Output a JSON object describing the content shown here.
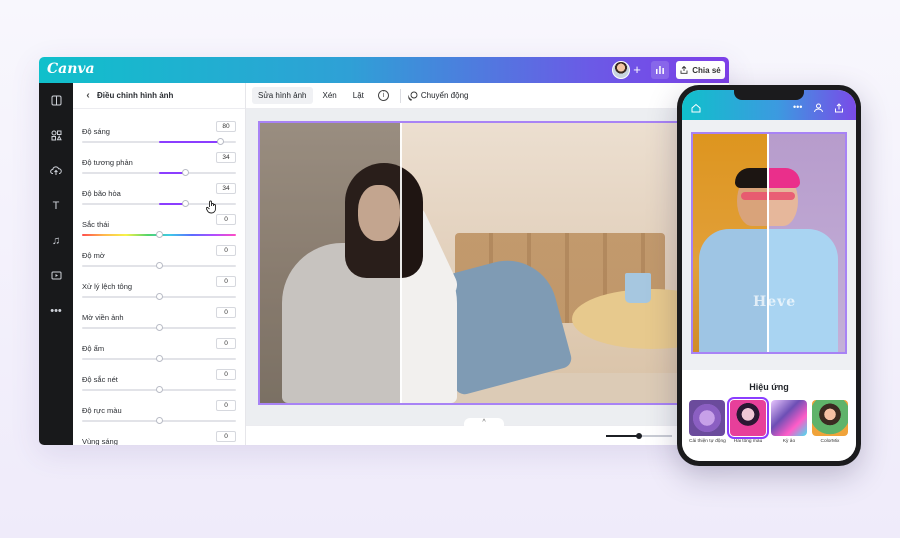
{
  "app": {
    "logo": "Canva"
  },
  "header": {
    "share_label": "Chia sẻ"
  },
  "panel": {
    "title": "Điều chỉnh hình ảnh",
    "sliders": [
      {
        "label": "Độ sáng",
        "value": "80",
        "fill": 0.9,
        "type": "normal"
      },
      {
        "label": "Độ tương phản",
        "value": "34",
        "fill": 0.67,
        "type": "normal"
      },
      {
        "label": "Độ bão hòa",
        "value": "34",
        "fill": 0.67,
        "type": "normal"
      },
      {
        "label": "Sắc thái",
        "value": "0",
        "fill": 0.5,
        "type": "hue"
      },
      {
        "label": "Độ mờ",
        "value": "0",
        "fill": 0.5,
        "type": "normal"
      },
      {
        "label": "Xử lý lệch tông",
        "value": "0",
        "fill": 0.5,
        "type": "normal"
      },
      {
        "label": "Mờ viền ảnh",
        "value": "0",
        "fill": 0.5,
        "type": "normal"
      },
      {
        "label": "Độ ấm",
        "value": "0",
        "fill": 0.5,
        "type": "normal"
      },
      {
        "label": "Độ sắc nét",
        "value": "0",
        "fill": 0.5,
        "type": "normal"
      },
      {
        "label": "Độ rực màu",
        "value": "0",
        "fill": 0.5,
        "type": "normal"
      },
      {
        "label": "Vùng sáng",
        "value": "0",
        "fill": 0.5,
        "type": "normal"
      }
    ]
  },
  "toolbar": {
    "edit_label": "Sửa hình ảnh",
    "crop_label": "Xén",
    "flip_label": "Lật",
    "info_glyph": "i",
    "animate_label": "Chuyển động"
  },
  "canvas": {
    "collapse_glyph": "^",
    "zoom_fill": 0.5
  },
  "phone": {
    "shirt_text": "Heve",
    "effects_title": "Hiệu ứng",
    "effects": [
      {
        "label": "Cải thiện tự động",
        "selected": false
      },
      {
        "label": "Hai tông màu",
        "selected": true
      },
      {
        "label": "Kỳ ảo",
        "selected": false
      },
      {
        "label": "ColorMix",
        "selected": false
      }
    ]
  },
  "colors": {
    "accent": "#8b3dff",
    "topbar_start": "#10c0cb",
    "topbar_end": "#7d3fe8"
  }
}
